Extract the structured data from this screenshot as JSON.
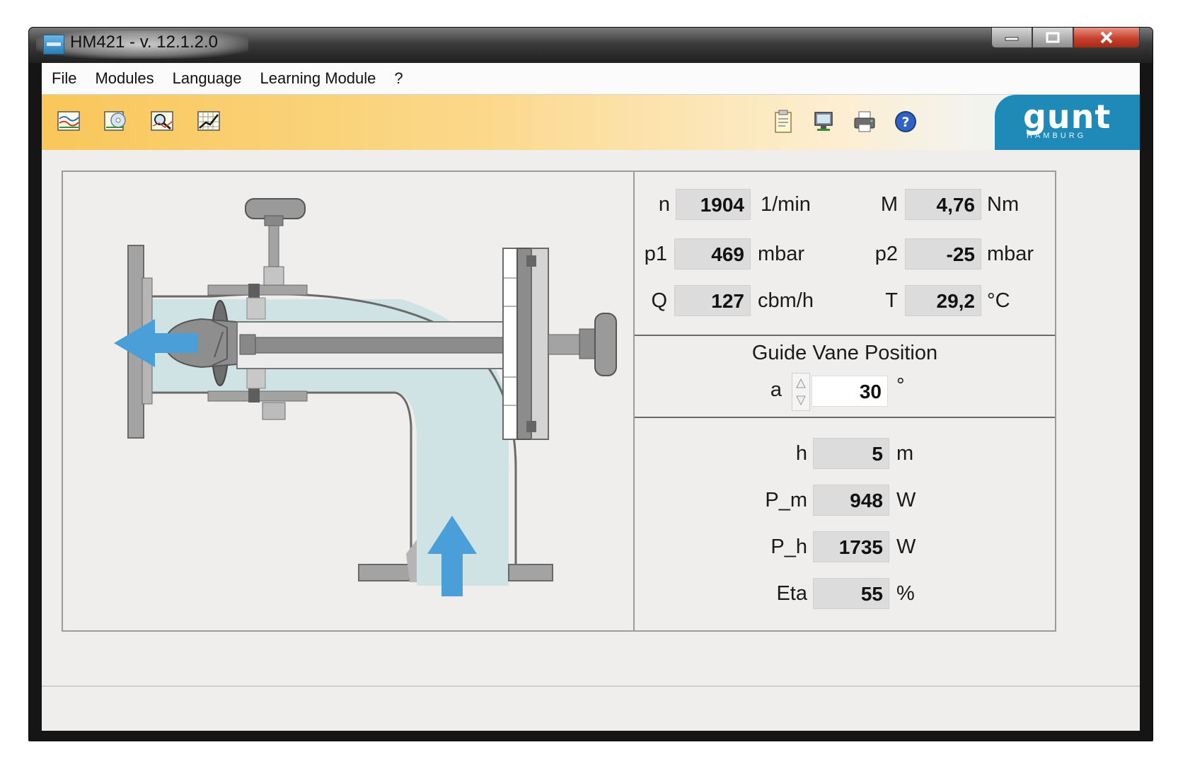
{
  "window": {
    "title": "HM421 - v. 12.1.2.0"
  },
  "menu": [
    "File",
    "Modules",
    "Language",
    "Learning Module",
    "?"
  ],
  "toolbar": {
    "left_icons": [
      "chart-icon",
      "disk-chart-icon",
      "zoom-chart-icon",
      "grid-chart-icon"
    ],
    "right_icons": [
      "clipboard-icon",
      "monitor-icon",
      "printer-icon",
      "help-icon"
    ],
    "logo": "gunt",
    "logo_sub": "HAMBURG"
  },
  "measurements": {
    "n": {
      "label": "n",
      "value": "1904",
      "unit": "1/min"
    },
    "M": {
      "label": "M",
      "value": "4,76",
      "unit": "Nm"
    },
    "p1": {
      "label": "p1",
      "value": "469",
      "unit": "mbar"
    },
    "p2": {
      "label": "p2",
      "value": "-25",
      "unit": "mbar"
    },
    "Q": {
      "label": "Q",
      "value": "127",
      "unit": "cbm/h"
    },
    "T": {
      "label": "T",
      "value": "29,2",
      "unit": "°C"
    }
  },
  "guide_vane": {
    "title": "Guide Vane Position",
    "label": "a",
    "value": "30",
    "unit": "°"
  },
  "results": {
    "h": {
      "label": "h",
      "value": "5",
      "unit": "m"
    },
    "P_m": {
      "label": "P_m",
      "value": "948",
      "unit": "W"
    },
    "P_h": {
      "label": "P_h",
      "value": "1735",
      "unit": "W"
    },
    "Eta": {
      "label": "Eta",
      "value": "55",
      "unit": "%"
    }
  },
  "colors": {
    "water": "#cfe3e5",
    "arrow": "#4a9fd8",
    "metal": "#a3a3a3",
    "metal_dark": "#7a7a7a",
    "logo_bg": "#1f8ab7"
  }
}
